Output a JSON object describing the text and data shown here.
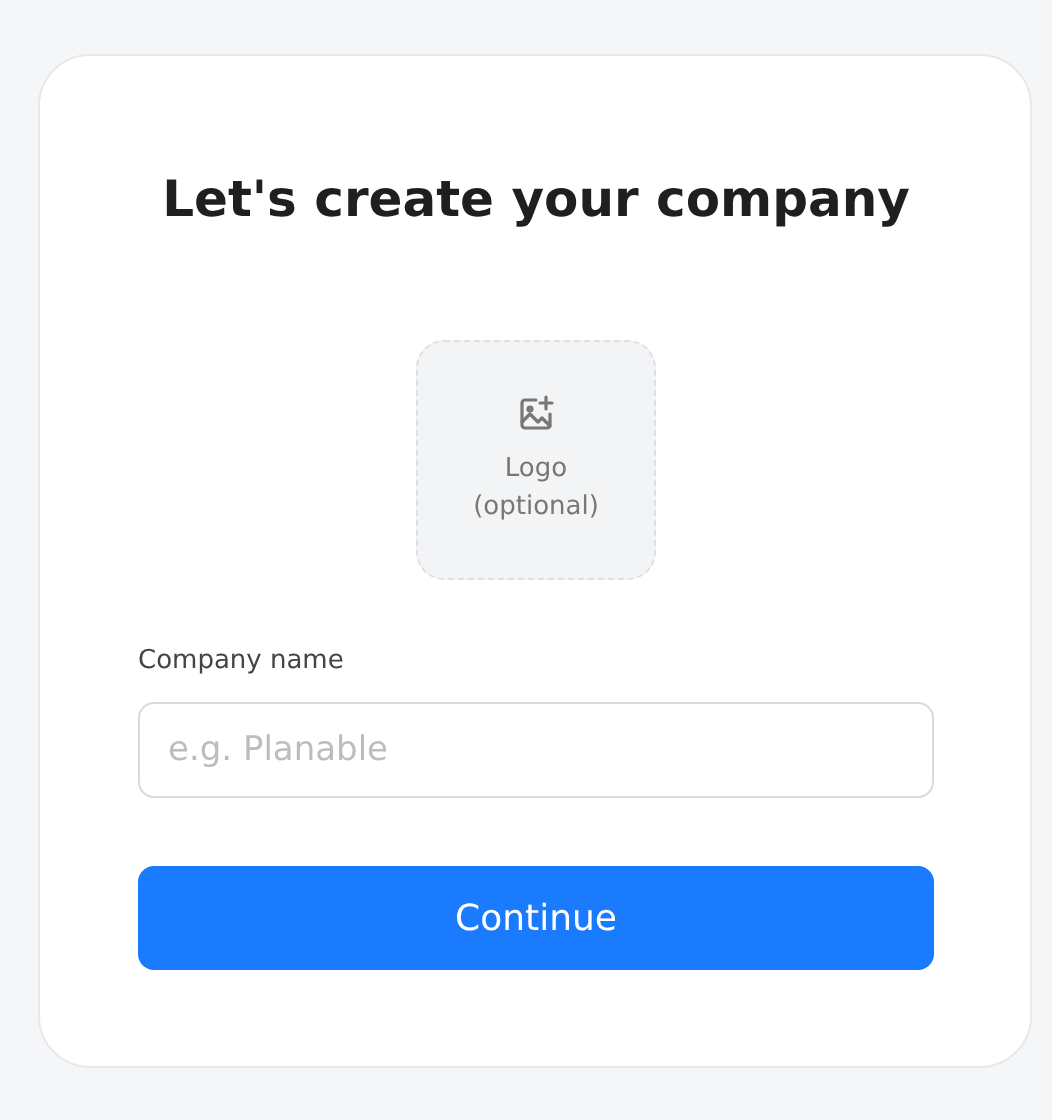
{
  "title": "Let's create your company",
  "logo_upload": {
    "lines": [
      "Logo",
      "(optional)"
    ]
  },
  "company_name": {
    "label": "Company name",
    "placeholder": "e.g. Planable"
  },
  "buttons": [
    "Continue"
  ]
}
